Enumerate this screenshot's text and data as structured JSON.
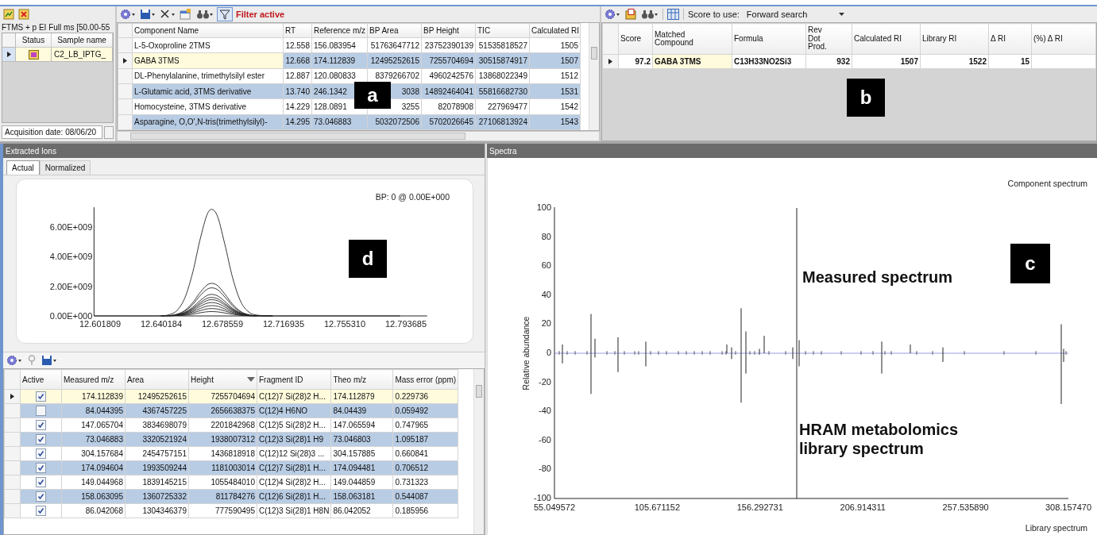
{
  "sample_panel": {
    "scan_filter": "FTMS + p EI Full ms [50.00-55",
    "columns": [
      "Status",
      "Sample name"
    ],
    "rows": [
      {
        "sample_name": "C2_LB_IPTG_",
        "selected": true
      }
    ],
    "acquisition_date": "Acquisition date: 08/06/20"
  },
  "components": {
    "filter_label": "Filter active",
    "filter_on": true,
    "columns": [
      "Component Name",
      "RT",
      "Reference m/z",
      "BP Area",
      "BP Height",
      "TIC",
      "Calculated RI"
    ],
    "rows": [
      {
        "selected": false,
        "cells": [
          "L-5-Oxoproline 2TMS",
          "12.558",
          "156.083954",
          "51763647712",
          "23752390139",
          "51535818527",
          "1505"
        ]
      },
      {
        "selected": true,
        "cells": [
          "GABA 3TMS",
          "12.668",
          "174.112839",
          "12495252615",
          "7255704694",
          "30515874917",
          "1507"
        ]
      },
      {
        "selected": false,
        "cells": [
          "DL-Phenylalanine, trimethylsilyl ester",
          "12.887",
          "120.080833",
          "8379266702",
          "4960242576",
          "13868022349",
          "1512"
        ]
      },
      {
        "selected": false,
        "cells": [
          "L-Glutamic acid, 3TMS derivative",
          "13.740",
          "246.1342",
          "3038",
          "14892464041",
          "55816682730",
          "1531"
        ]
      },
      {
        "selected": false,
        "cells": [
          "Homocysteine, 3TMS derivative",
          "14.229",
          "128.0891",
          "3255",
          "82078908",
          "227969477",
          "1542"
        ]
      },
      {
        "selected": false,
        "cells": [
          "Asparagine, O,O',N-tris(trimethylsilyl)-",
          "14.295",
          "73.046883",
          "5032072506",
          "5702026645",
          "27106813924",
          "1543"
        ]
      }
    ]
  },
  "matches": {
    "score_label": "Score to use:",
    "score_value": "Forward search",
    "columns": [
      "Score",
      "Matched Compound",
      "Formula",
      "Rev Dot Prod.",
      "Calculated RI",
      "Library RI",
      "Δ RI",
      "(%) Δ RI"
    ],
    "rows": [
      {
        "selected": true,
        "cells": [
          "97.2",
          "GABA 3TMS",
          "C13H33NO2Si3",
          "932",
          "1507",
          "1522",
          "15"
        ]
      }
    ]
  },
  "extracted_ions": {
    "title": "Extracted Ions",
    "tabs": [
      {
        "label": "Actual",
        "selected": true
      },
      {
        "label": "Normalized",
        "selected": false
      }
    ],
    "bp_label": "BP: 0 @ 0.00E+000",
    "chart_data": {
      "type": "line",
      "x": [
        12.598,
        12.63,
        12.64,
        12.645,
        12.65,
        12.655,
        12.66,
        12.665,
        12.67,
        12.675,
        12.68,
        12.685,
        12.69,
        12.695,
        12.7,
        12.71,
        12.72,
        12.79
      ],
      "series": [
        {
          "values": [
            0,
            0,
            10000000.0,
            80000000.0,
            360000000.0,
            1210000000.0,
            2960000000.0,
            5330000000.0,
            7030000000.0,
            6810000000.0,
            4850000000.0,
            2550000000.0,
            970000000.0,
            270000000.0,
            60000000.0,
            0,
            0,
            0
          ]
        },
        {
          "values": [
            null,
            null,
            0,
            20000000.0,
            110000000.0,
            370000000.0,
            900000000.0,
            1630000000.0,
            2150000000.0,
            2080000000.0,
            1480000000.0,
            780000000.0,
            300000000.0,
            80000000.0,
            20000000.0,
            0,
            null,
            null
          ]
        },
        {
          "values": [
            null,
            null,
            null,
            20000000.0,
            100000000.0,
            320000000.0,
            780000000.0,
            1410000000.0,
            1850000000.0,
            1800000000.0,
            1280000000.0,
            670000000.0,
            260000000.0,
            70000000.0,
            20000000.0,
            null,
            null,
            null
          ]
        },
        {
          "values": [
            null,
            null,
            null,
            null,
            70000000.0,
            240000000.0,
            600000000.0,
            1070000000.0,
            1420000000.0,
            1370000000.0,
            980000000.0,
            510000000.0,
            200000000.0,
            60000000.0,
            null,
            null,
            null,
            null
          ]
        },
        {
          "values": [
            null,
            null,
            0,
            10000000.0,
            60000000.0,
            210000000.0,
            510000000.0,
            930000000.0,
            1220000000.0,
            1180000000.0,
            840000000.0,
            440000000.0,
            170000000.0,
            50000000.0,
            10000000.0,
            null,
            null,
            null
          ]
        },
        {
          "values": [
            null,
            null,
            null,
            10000000.0,
            60000000.0,
            180000000.0,
            450000000.0,
            810000000.0,
            1070000000.0,
            1040000000.0,
            740000000.0,
            390000000.0,
            150000000.0,
            40000000.0,
            null,
            null,
            null,
            null
          ]
        },
        {
          "values": [
            null,
            null,
            null,
            null,
            50000000.0,
            150000000.0,
            370000000.0,
            670000000.0,
            880000000.0,
            850000000.0,
            610000000.0,
            320000000.0,
            120000000.0,
            30000000.0,
            10000000.0,
            0,
            null,
            null
          ]
        },
        {
          "values": [
            null,
            null,
            0,
            10000000.0,
            40000000.0,
            120000000.0,
            290000000.0,
            520000000.0,
            680000000.0,
            660000000.0,
            470000000.0,
            250000000.0,
            90000000.0,
            30000000.0,
            null,
            null,
            null,
            null
          ]
        },
        {
          "values": [
            null,
            null,
            null,
            10000000.0,
            30000000.0,
            80000000.0,
            210000000.0,
            370000000.0,
            490000000.0,
            470000000.0,
            340000000.0,
            180000000.0,
            70000000.0,
            20000000.0,
            0,
            0,
            null,
            null
          ]
        },
        {
          "values": [
            null,
            null,
            null,
            null,
            20000000.0,
            50000000.0,
            120000000.0,
            220000000.0,
            290000000.0,
            280000000.0,
            200000000.0,
            110000000.0,
            40000000.0,
            10000000.0,
            0,
            null,
            null,
            null
          ]
        }
      ],
      "xlim": [
        12.598,
        12.807
      ],
      "ylim": [
        0,
        7300000000.0
      ],
      "xticks": [
        {
          "value": 12.601809,
          "label": "12.601809"
        },
        {
          "value": 12.640184,
          "label": "12.640184"
        },
        {
          "value": 12.678559,
          "label": "12.678559"
        },
        {
          "value": 12.716935,
          "label": "12.716935"
        },
        {
          "value": 12.75531,
          "label": "12.755310"
        },
        {
          "value": 12.793685,
          "label": "12.793685"
        }
      ],
      "yticks": [
        {
          "value": 0,
          "label": "0.00E+000"
        },
        {
          "value": 2000000000.0,
          "label": "2.00E+009"
        },
        {
          "value": 4000000000.0,
          "label": "4.00E+009"
        },
        {
          "value": 6000000000.0,
          "label": "6.00E+009"
        }
      ]
    }
  },
  "ion_table": {
    "check_column": "Active",
    "columns": [
      {
        "label": "Measured m/z",
        "sorted": false
      },
      {
        "label": "Area",
        "sorted": false
      },
      {
        "label": "Height",
        "sorted": true
      },
      {
        "label": "Fragment ID",
        "sorted": false
      },
      {
        "label": "Theo m/z",
        "sorted": false
      },
      {
        "label": "Mass error (ppm)",
        "sorted": false
      }
    ],
    "rows": [
      {
        "selected": true,
        "checked": true,
        "cells": [
          "174.112839",
          "12495252615",
          "7255704694",
          "C(12)7 Si(28)2 H...",
          "174.112879",
          "0.229736"
        ]
      },
      {
        "selected": false,
        "checked": false,
        "cells": [
          "84.044395",
          "4367457225",
          "2656638375",
          "C(12)4 H6NO",
          "84.04439",
          "0.059492"
        ]
      },
      {
        "selected": false,
        "checked": true,
        "cells": [
          "147.065704",
          "3834698079",
          "2201842968",
          "C(12)5 Si(28)2 H...",
          "147.065594",
          "0.747965"
        ]
      },
      {
        "selected": false,
        "checked": true,
        "cells": [
          "73.046883",
          "3320521924",
          "1938007312",
          "C(12)3 Si(28)1 H9",
          "73.046803",
          "1.095187"
        ]
      },
      {
        "selected": false,
        "checked": true,
        "cells": [
          "304.157684",
          "2454757151",
          "1436818918",
          "C(12)12 Si(28)3 ...",
          "304.157885",
          "0.660841"
        ]
      },
      {
        "selected": false,
        "checked": true,
        "cells": [
          "174.094604",
          "1993509244",
          "1181003014",
          "C(12)7 Si(28)1 H...",
          "174.094481",
          "0.706512"
        ]
      },
      {
        "selected": false,
        "checked": true,
        "cells": [
          "149.044968",
          "1839145215",
          "1055484010",
          "C(12)4 Si(28)2 H...",
          "149.044859",
          "0.731323"
        ]
      },
      {
        "selected": false,
        "checked": true,
        "cells": [
          "158.063095",
          "1360725332",
          "811784276",
          "C(12)6 Si(28)1 H...",
          "158.063181",
          "0.544087"
        ]
      },
      {
        "selected": false,
        "checked": true,
        "cells": [
          "86.042068",
          "1304346379",
          "777590495",
          "C(12)3 Si(28)1 H8N",
          "86.042052",
          "0.185956"
        ]
      }
    ]
  },
  "spectra": {
    "title": "Spectra",
    "top_label": "Component spectrum",
    "bottom_label": "Library spectrum",
    "ylabel": "Relative abundance",
    "y_ticks": [
      "100",
      "80",
      "60",
      "40",
      "20",
      "0",
      "-20",
      "-40",
      "-60",
      "-80",
      "-100"
    ],
    "x_ticks": [
      "55.049572",
      "105.671152",
      "156.292731",
      "206.914311",
      "257.535890",
      "308.157470"
    ],
    "annotations": [
      "Measured spectrum",
      "HRAM metabolomics library spectrum"
    ]
  },
  "panel_labels": {
    "components": "a",
    "matches": "b",
    "spectra": "c",
    "ions": "d"
  }
}
